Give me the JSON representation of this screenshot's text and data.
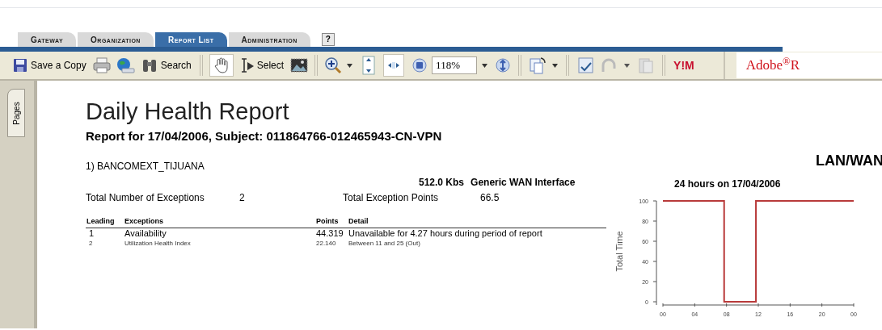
{
  "tabs": [
    {
      "label": "Gateway",
      "selected": false
    },
    {
      "label": "Organization",
      "selected": false
    },
    {
      "label": "Report List",
      "selected": true
    },
    {
      "label": "Administration",
      "selected": false
    }
  ],
  "help_button": "?",
  "toolbar": {
    "save_label": "Save a Copy",
    "search_label": "Search",
    "select_label": "Select",
    "zoom_value": "118%",
    "messenger": "Y!M",
    "adobe_logo": "Adobe$^{®}$R"
  },
  "sidebar": {
    "tab": "Pages"
  },
  "report": {
    "title": "Daily Health Report",
    "subtitle": "Report for 17/04/2006, Subject: 011864766-012465943-CN-VPN",
    "section": "1) BANCOMEXT_TIJUANA",
    "bandwidth": "512.0 Kbs",
    "interface": "Generic WAN Interface",
    "exceptions_label": "Total Number of Exceptions",
    "exceptions_value": "2",
    "points_label": "Total Exception Points",
    "points_value": "66.5",
    "table": {
      "columns": [
        "Leading",
        "Exceptions",
        "Points",
        "Detail"
      ],
      "rows": [
        [
          "1",
          "Availability",
          "44.319",
          "Unavailable for 4.27 hours during period of report"
        ],
        [
          "2",
          "Utilization Health Index",
          "22.140",
          "Between 11 and 25 (Out)"
        ]
      ]
    },
    "side_heading": "LAN/WAN",
    "chart_data": {
      "type": "line",
      "title": "24 hours on 17/04/2006",
      "ylabel": "Total Time",
      "x": [
        0,
        7.7,
        7.7,
        11.7,
        11.7,
        24
      ],
      "series": [
        {
          "color": "#b83a3a",
          "values": [
            100,
            100,
            0,
            0,
            100,
            100
          ]
        }
      ],
      "xlim": [
        0,
        24
      ],
      "ylim": [
        0,
        100
      ],
      "xticks": [
        {
          "value": 0,
          "label": "00"
        },
        {
          "value": 4,
          "label": "04"
        },
        {
          "value": 8,
          "label": "08"
        },
        {
          "value": 12,
          "label": "12"
        },
        {
          "value": 16,
          "label": "16"
        },
        {
          "value": 20,
          "label": "20"
        },
        {
          "value": 24,
          "label": "00"
        }
      ],
      "yticks": [
        0,
        20,
        40,
        60,
        80,
        100
      ]
    }
  }
}
